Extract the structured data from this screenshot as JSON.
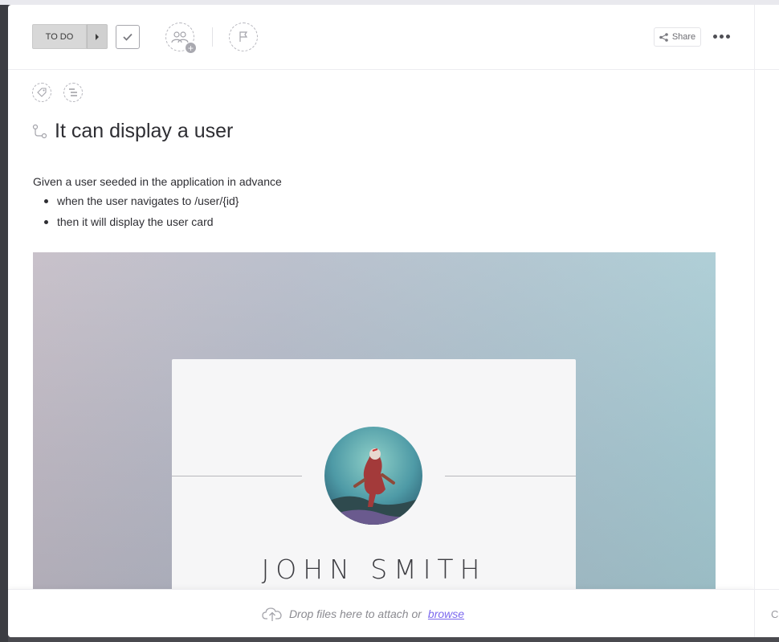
{
  "toolbar": {
    "status_label": "TO DO",
    "share_label": "Share"
  },
  "task": {
    "title": "It can display a user",
    "description_intro": "Given a user seeded in the application in advance",
    "steps": [
      "when the user navigates to /user/{id}",
      "then it will display the user card"
    ]
  },
  "embedded_image": {
    "card_name": "JOHN SMITH"
  },
  "dropzone": {
    "text": "Drop files here to attach or",
    "browse_label": "browse"
  },
  "right_rail": {
    "footer_letter": "C"
  },
  "colors": {
    "accent": "#7b68ee",
    "status_bg": "#d8d8d8"
  },
  "icons": [
    "check-icon",
    "assignee-icon",
    "flag-icon",
    "share-icon",
    "more-icon",
    "tag-icon",
    "subtask-icon",
    "subtask-title-icon",
    "upload-cloud-icon"
  ]
}
